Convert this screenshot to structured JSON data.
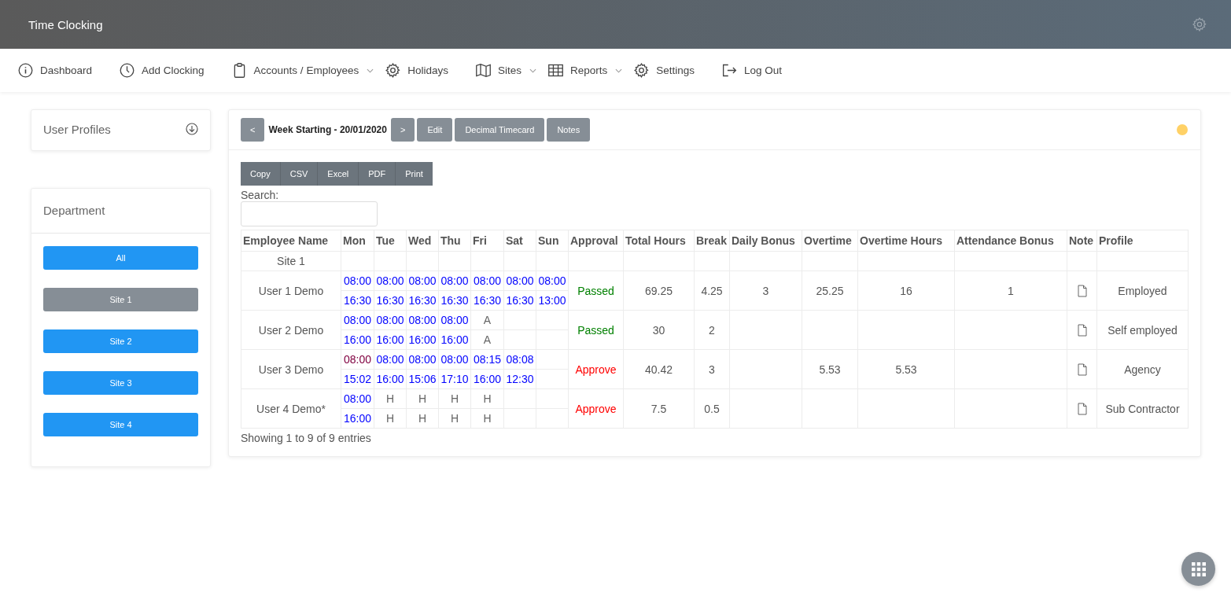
{
  "app": {
    "title": "Time Clocking"
  },
  "nav": [
    {
      "label": "Dashboard",
      "dropdown": false
    },
    {
      "label": "Add Clocking",
      "dropdown": false
    },
    {
      "label": "Accounts / Employees",
      "dropdown": true
    },
    {
      "label": "Holidays",
      "dropdown": false
    },
    {
      "label": "Sites",
      "dropdown": true
    },
    {
      "label": "Reports",
      "dropdown": true
    },
    {
      "label": "Settings",
      "dropdown": false
    },
    {
      "label": "Log Out",
      "dropdown": false
    }
  ],
  "sidebar": {
    "profiles_title": "User Profiles",
    "department_title": "Department",
    "departments": [
      {
        "label": "All",
        "selected": false
      },
      {
        "label": "Site 1",
        "selected": true
      },
      {
        "label": "Site 2",
        "selected": false
      },
      {
        "label": "Site 3",
        "selected": false
      },
      {
        "label": "Site 4",
        "selected": false
      }
    ]
  },
  "week": {
    "prev": "<",
    "label": "Week Starting - 20/01/2020",
    "next": ">",
    "buttons": [
      "Edit",
      "Decimal Timecard",
      "Notes"
    ]
  },
  "export_buttons": [
    "Copy",
    "CSV",
    "Excel",
    "PDF",
    "Print"
  ],
  "search": {
    "label": "Search:"
  },
  "table": {
    "columns": [
      "Employee Name",
      "Mon",
      "Tue",
      "Wed",
      "Thu",
      "Fri",
      "Sat",
      "Sun",
      "Approval",
      "Total Hours",
      "Break",
      "Daily Bonus",
      "Overtime",
      "Overtime Hours",
      "Attendance Bonus",
      "Note",
      "Profile"
    ],
    "group": "Site 1",
    "rows": [
      {
        "name": "User 1 Demo",
        "days": [
          [
            {
              "text": "08:00",
              "kind": "time"
            },
            {
              "text": "16:30",
              "kind": "time"
            }
          ],
          [
            {
              "text": "08:00",
              "kind": "time"
            },
            {
              "text": "16:30",
              "kind": "time"
            }
          ],
          [
            {
              "text": "08:00",
              "kind": "time"
            },
            {
              "text": "16:30",
              "kind": "time"
            }
          ],
          [
            {
              "text": "08:00",
              "kind": "time"
            },
            {
              "text": "16:30",
              "kind": "time"
            }
          ],
          [
            {
              "text": "08:00",
              "kind": "time"
            },
            {
              "text": "16:30",
              "kind": "time"
            }
          ],
          [
            {
              "text": "08:00",
              "kind": "time"
            },
            {
              "text": "16:30",
              "kind": "time"
            }
          ],
          [
            {
              "text": "08:00",
              "kind": "time"
            },
            {
              "text": "13:00",
              "kind": "time"
            }
          ]
        ],
        "approval": {
          "text": "Passed",
          "kind": "passed"
        },
        "total": "69.25",
        "break": "4.25",
        "daily_bonus": "3",
        "overtime": "25.25",
        "overtime_hours": "16",
        "attendance_bonus": "1",
        "profile": "Employed"
      },
      {
        "name": "User 2 Demo",
        "days": [
          [
            {
              "text": "08:00",
              "kind": "time"
            },
            {
              "text": "16:00",
              "kind": "time"
            }
          ],
          [
            {
              "text": "08:00",
              "kind": "time"
            },
            {
              "text": "16:00",
              "kind": "time"
            }
          ],
          [
            {
              "text": "08:00",
              "kind": "time"
            },
            {
              "text": "16:00",
              "kind": "time"
            }
          ],
          [
            {
              "text": "08:00",
              "kind": "time"
            },
            {
              "text": "16:00",
              "kind": "time"
            }
          ],
          [
            {
              "text": "A",
              "kind": "code"
            },
            {
              "text": "A",
              "kind": "code"
            }
          ]
        ],
        "approval": {
          "text": "Passed",
          "kind": "passed"
        },
        "total": "30",
        "break": "2",
        "profile": "Self employed"
      },
      {
        "name": "User 3 Demo",
        "days": [
          [
            {
              "text": "08:00",
              "kind": "flagged"
            },
            {
              "text": "15:02",
              "kind": "time"
            }
          ],
          [
            {
              "text": "08:00",
              "kind": "time"
            },
            {
              "text": "16:00",
              "kind": "time"
            }
          ],
          [
            {
              "text": "08:00",
              "kind": "time"
            },
            {
              "text": "15:06",
              "kind": "time"
            }
          ],
          [
            {
              "text": "08:00",
              "kind": "time"
            },
            {
              "text": "17:10",
              "kind": "time"
            }
          ],
          [
            {
              "text": "08:15",
              "kind": "time"
            },
            {
              "text": "16:00",
              "kind": "time"
            }
          ],
          [
            {
              "text": "08:08",
              "kind": "time"
            },
            {
              "text": "12:30",
              "kind": "time"
            }
          ]
        ],
        "approval": {
          "text": "Approve",
          "kind": "pending"
        },
        "total": "40.42",
        "break": "3",
        "overtime": "5.53",
        "overtime_hours": "5.53",
        "profile": "Agency"
      },
      {
        "name": "User 4 Demo*",
        "days": [
          [
            {
              "text": "08:00",
              "kind": "time"
            },
            {
              "text": "16:00",
              "kind": "time"
            }
          ],
          [
            {
              "text": "H",
              "kind": "code"
            },
            {
              "text": "H",
              "kind": "code"
            }
          ],
          [
            {
              "text": "H",
              "kind": "code"
            },
            {
              "text": "H",
              "kind": "code"
            }
          ],
          [
            {
              "text": "H",
              "kind": "code"
            },
            {
              "text": "H",
              "kind": "code"
            }
          ],
          [
            {
              "text": "H",
              "kind": "code"
            },
            {
              "text": "H",
              "kind": "code"
            }
          ]
        ],
        "approval": {
          "text": "Approve",
          "kind": "pending"
        },
        "total": "7.5",
        "break": "0.5",
        "profile": "Sub Contractor"
      }
    ],
    "footer": "Showing 1 to 9 of 9 entries"
  }
}
